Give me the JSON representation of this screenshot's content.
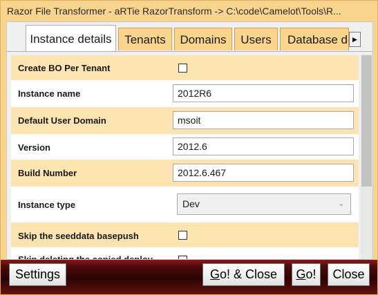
{
  "window": {
    "title": "Razor File Transformer - aRTie  RazorTransform -> C:\\code\\Camelot\\Tools\\R..."
  },
  "tabs": [
    {
      "label": "Instance details",
      "active": true
    },
    {
      "label": "Tenants",
      "active": false
    },
    {
      "label": "Domains",
      "active": false
    },
    {
      "label": "Users",
      "active": false
    },
    {
      "label": "Database de",
      "active": false
    }
  ],
  "tab_scroll_icon": "right-arrow-icon",
  "fields": {
    "create_bo": {
      "label": "Create BO Per Tenant",
      "checked": false
    },
    "instance_name": {
      "label": "Instance name",
      "value": "2012R6"
    },
    "default_user_domain": {
      "label": "Default User Domain",
      "value": "msoit"
    },
    "version": {
      "label": "Version",
      "value": "2012.6"
    },
    "build_number": {
      "label": "Build Number",
      "value": "2012.6.467"
    },
    "instance_type": {
      "label": "Instance type",
      "value": "Dev"
    },
    "skip_seeddata": {
      "label": "Skip the seeddata basepush",
      "checked": false
    },
    "skip_deleting": {
      "label": "Skip deleting the copied deploy",
      "checked": false
    }
  },
  "buttons": {
    "settings": "Settings",
    "go_close_mn": "G",
    "go_close_rest": "o! & Close",
    "go_mn": "G",
    "go_rest": "o!",
    "close": "Close"
  },
  "colors": {
    "accent": "#f9d48c",
    "row_shade": "#fbe3b2",
    "bottom_bar": "#4b0a0a"
  }
}
